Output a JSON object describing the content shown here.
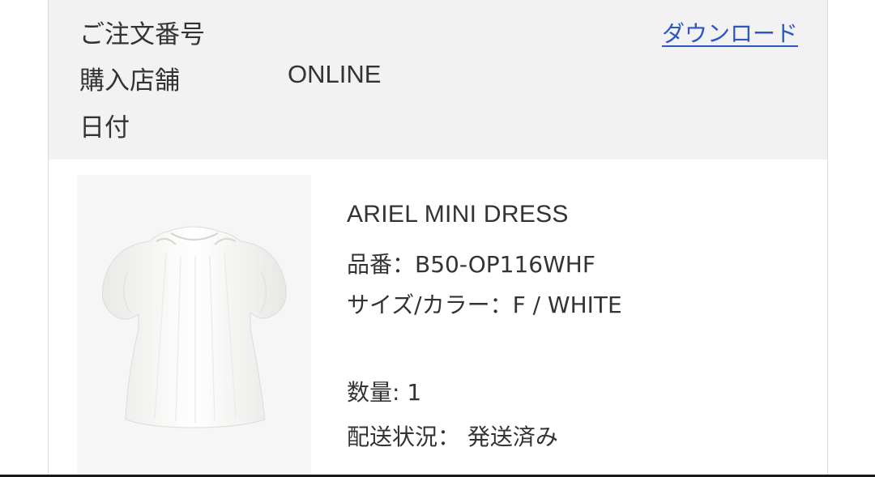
{
  "order_header": {
    "order_number_label": "ご注文番号",
    "store_label": "購入店舗",
    "store_value": "ONLINE",
    "date_label": "日付",
    "download_label": "ダウンロード"
  },
  "product": {
    "name": "ARIEL MINI DRESS",
    "sku": "品番：B50-OP116WHF",
    "size_color": "サイズ/カラー：F / WHITE",
    "quantity": "数量: 1",
    "shipping_status": "配送状況： 発送済み",
    "image_icon": "white-puff-sleeve-dress-photo"
  },
  "colors": {
    "header_bg": "#f2f2f2",
    "link": "#2c58c4",
    "text": "#333333"
  }
}
